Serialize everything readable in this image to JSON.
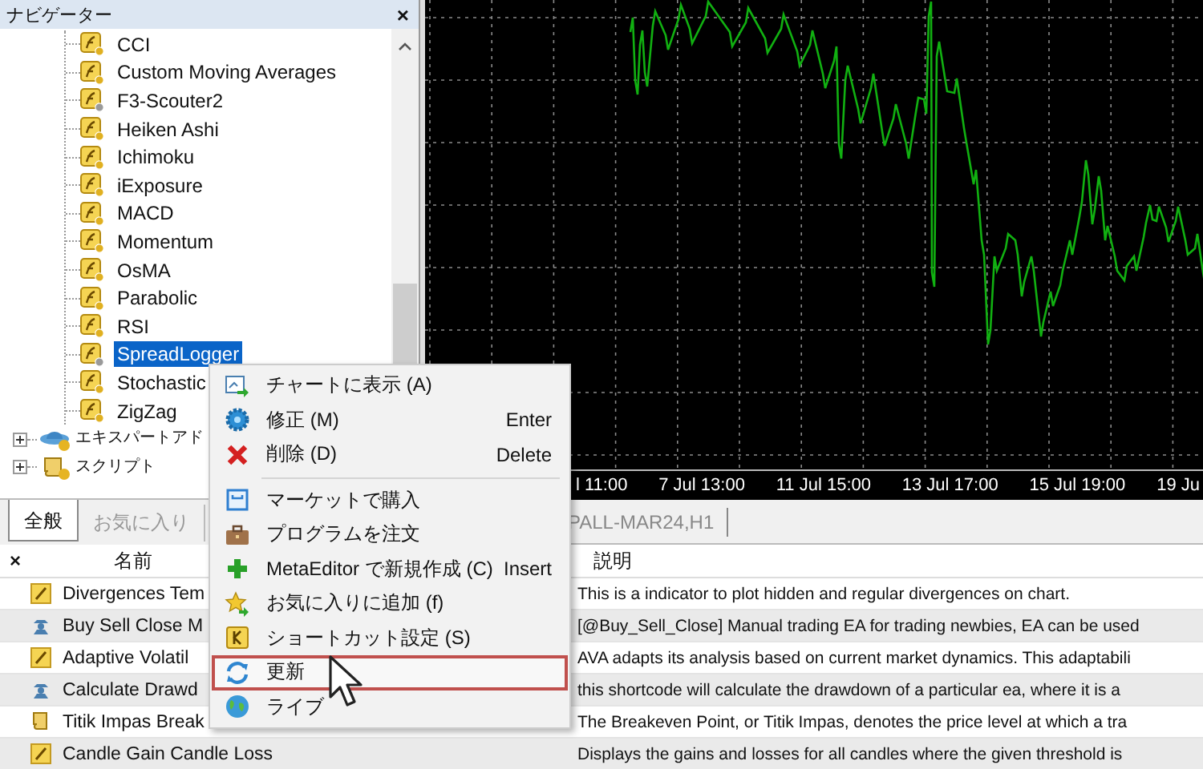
{
  "navigator": {
    "title": "ナビゲーター",
    "close": "×",
    "indicators": [
      {
        "label": "CCI",
        "selected": false
      },
      {
        "label": "Custom Moving Averages",
        "selected": false
      },
      {
        "label": "F3-Scouter2",
        "selected": false
      },
      {
        "label": "Heiken Ashi",
        "selected": false
      },
      {
        "label": "Ichimoku",
        "selected": false
      },
      {
        "label": "iExposure",
        "selected": false
      },
      {
        "label": "MACD",
        "selected": false
      },
      {
        "label": "Momentum",
        "selected": false
      },
      {
        "label": "OsMA",
        "selected": false
      },
      {
        "label": "Parabolic",
        "selected": false
      },
      {
        "label": "RSI",
        "selected": false
      },
      {
        "label": "SpreadLogger",
        "selected": true
      },
      {
        "label": "Stochastic",
        "selected": false
      },
      {
        "label": "ZigZag",
        "selected": false
      }
    ],
    "folders": [
      {
        "label": "エキスパートアド",
        "kind": "expert",
        "expanded": false
      },
      {
        "label": "スクリプト",
        "kind": "script",
        "expanded": false
      }
    ],
    "tabs": [
      {
        "label": "全般",
        "selected": true
      },
      {
        "label": "お気に入り",
        "selected": false
      }
    ]
  },
  "chart": {
    "time_labels": [
      "l 11:00",
      "7 Jul 13:00",
      "11 Jul 15:00",
      "13 Jul 17:00",
      "15 Jul 19:00",
      "19 Ju"
    ],
    "tab": "PALL-MAR24,H1"
  },
  "context_menu": {
    "items": [
      {
        "kind": "item",
        "label": "チャートに表示 (A)",
        "selected": false
      },
      {
        "kind": "item",
        "label": "修正 (M)",
        "shortcut": "Enter",
        "selected": false
      },
      {
        "kind": "item",
        "label": "削除 (D)",
        "shortcut": "Delete",
        "selected": false
      },
      {
        "kind": "separator"
      },
      {
        "kind": "item",
        "label": "マーケットで購入",
        "selected": false
      },
      {
        "kind": "item",
        "label": "プログラムを注文",
        "selected": false
      },
      {
        "kind": "item",
        "label": "MetaEditor で新規作成 (C)",
        "shortcut": "Insert",
        "selected": false
      },
      {
        "kind": "item",
        "label": "お気に入りに追加 (f)",
        "selected": false
      },
      {
        "kind": "item",
        "label": "ショートカット設定 (S)",
        "selected": false
      },
      {
        "kind": "item",
        "label": "更新",
        "selected": true
      },
      {
        "kind": "item",
        "label": "ライブ",
        "selected": false
      }
    ]
  },
  "table": {
    "close": "×",
    "columns": [
      "名前",
      "説明"
    ],
    "rows": [
      {
        "kind": "indicator",
        "name": "Divergences Tem",
        "description": "This is a indicator to plot hidden and regular divergences on chart."
      },
      {
        "kind": "expert",
        "name": "Buy Sell Close M",
        "description": "[@Buy_Sell_Close] Manual trading EA for trading newbies, EA can be used"
      },
      {
        "kind": "indicator",
        "name": "Adaptive Volatil",
        "description": "AVA adapts its analysis based on current market dynamics. This adaptabili"
      },
      {
        "kind": "expert",
        "name": "Calculate Drawd",
        "description": "this shortcode will calculate the drawdown of a particular ea, where it is a"
      },
      {
        "kind": "script",
        "name": "Titik Impas Break",
        "description": "The Breakeven Point, or Titik Impas, denotes the price level at which a tra"
      },
      {
        "kind": "indicator",
        "name": "Candle Gain Candle Loss",
        "description": "Displays the gains and losses for all candles where the given threshold is"
      }
    ]
  }
}
